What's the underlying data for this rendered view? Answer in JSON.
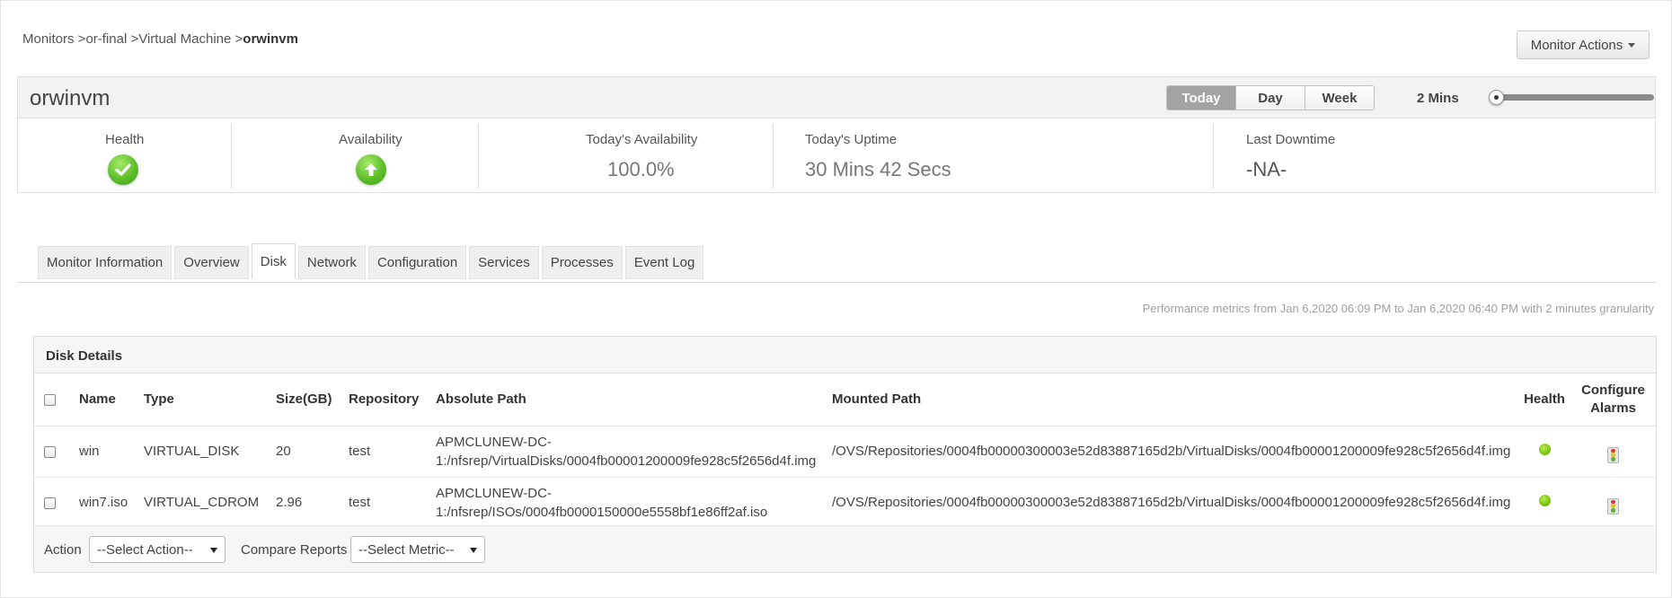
{
  "breadcrumb": {
    "items": [
      "Monitors >",
      "or-final >",
      "Virtual Machine >"
    ],
    "current": "orwinvm"
  },
  "monitor_actions": {
    "label": "Monitor Actions"
  },
  "header": {
    "title": "orwinvm",
    "periods": [
      "Today",
      "Day",
      "Week"
    ],
    "active_period": "Today",
    "granularity": "2 Mins"
  },
  "stats": {
    "health_label": "Health",
    "health_icon": "check-icon",
    "availability_label": "Availability",
    "availability_icon": "arrow-up-icon",
    "todays_availability_label": "Today's Availability",
    "todays_availability_value": "100.0%",
    "todays_uptime_label": "Today's Uptime",
    "todays_uptime_value": "30 Mins 42 Secs",
    "last_downtime_label": "Last Downtime",
    "last_downtime_value": "-NA-",
    "colors": {
      "status_green": "#5cbf2a"
    }
  },
  "tabs": [
    "Monitor Information",
    "Overview",
    "Disk",
    "Network",
    "Configuration",
    "Services",
    "Processes",
    "Event Log"
  ],
  "active_tab": "Disk",
  "perf_note": "Performance metrics from Jan 6,2020 06:09 PM to Jan 6,2020 06:40 PM with 2 minutes granularity",
  "disk_details": {
    "title": "Disk Details",
    "columns": {
      "name": "Name",
      "type": "Type",
      "size": "Size(GB)",
      "repository": "Repository",
      "absolute_path": "Absolute Path",
      "mounted_path": "Mounted Path",
      "health": "Health",
      "configure_alarms_1": "Configure",
      "configure_alarms_2": "Alarms"
    },
    "rows": [
      {
        "name": "win",
        "type": "VIRTUAL_DISK",
        "size": "20",
        "repository": "test",
        "absolute_path_1": "APMCLUNEW-DC-",
        "absolute_path_2": "1:/nfsrep/VirtualDisks/0004fb00001200009fe928c5f2656d4f.img",
        "mounted_path": "/OVS/Repositories/0004fb00000300003e52d83887165d2b/VirtualDisks/0004fb00001200009fe928c5f2656d4f.img",
        "health": "green"
      },
      {
        "name": "win7.iso",
        "type": "VIRTUAL_CDROM",
        "size": "2.96",
        "repository": "test",
        "absolute_path_1": "APMCLUNEW-DC-",
        "absolute_path_2": "1:/nfsrep/ISOs/0004fb0000150000e5558bf1e86ff2af.iso",
        "mounted_path": "/OVS/Repositories/0004fb00000300003e52d83887165d2b/VirtualDisks/0004fb00001200009fe928c5f2656d4f.img",
        "health": "green"
      }
    ],
    "footer": {
      "action_label": "Action",
      "action_select": "--Select Action--",
      "compare_label": "Compare Reports",
      "compare_select": "--Select Metric--"
    }
  }
}
